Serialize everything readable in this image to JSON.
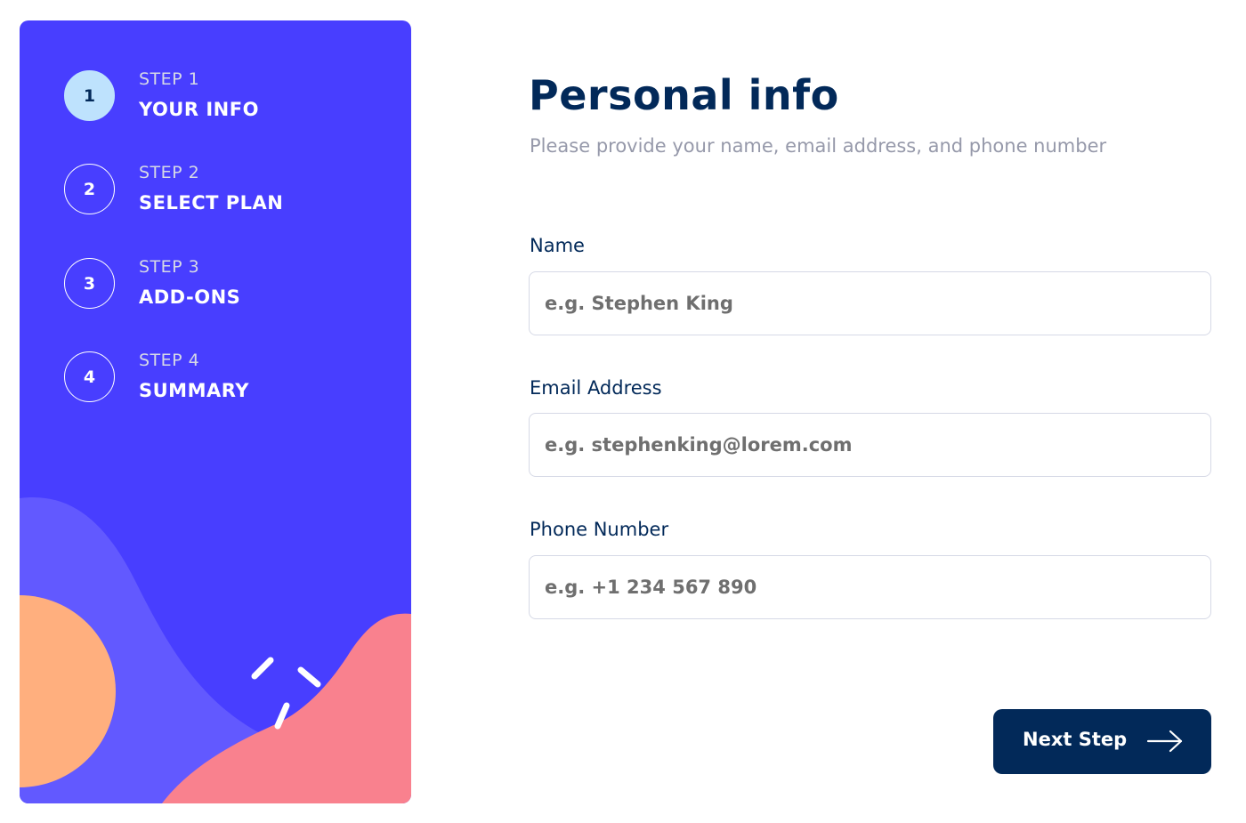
{
  "colors": {
    "sidebar_bg": "#483eff",
    "active_step_bg": "#bee2fd",
    "primary_text": "#022959",
    "muted_text": "#9699aa",
    "border": "#d6d9e6",
    "button_bg": "#022959",
    "decor_orange": "#ffaf7e",
    "decor_pink": "#f9818e",
    "decor_violet": "#6259ff"
  },
  "sidebar": {
    "steps": [
      {
        "number": "1",
        "step_label": "STEP 1",
        "title": "YOUR INFO",
        "active": true
      },
      {
        "number": "2",
        "step_label": "STEP 2",
        "title": "SELECT PLAN",
        "active": false
      },
      {
        "number": "3",
        "step_label": "STEP 3",
        "title": "ADD-ONS",
        "active": false
      },
      {
        "number": "4",
        "step_label": "STEP 4",
        "title": "SUMMARY",
        "active": false
      }
    ]
  },
  "main": {
    "title": "Personal info",
    "subtitle": "Please provide your name, email address, and phone number",
    "fields": {
      "name": {
        "label": "Name",
        "placeholder": "e.g. Stephen King",
        "value": ""
      },
      "email": {
        "label": "Email Address",
        "placeholder": "e.g. stephenking@lorem.com",
        "value": ""
      },
      "phone": {
        "label": "Phone Number",
        "placeholder": "e.g. +1 234 567 890",
        "value": ""
      }
    },
    "next_button": {
      "label": "Next Step",
      "icon": "arrow-right-icon"
    }
  }
}
